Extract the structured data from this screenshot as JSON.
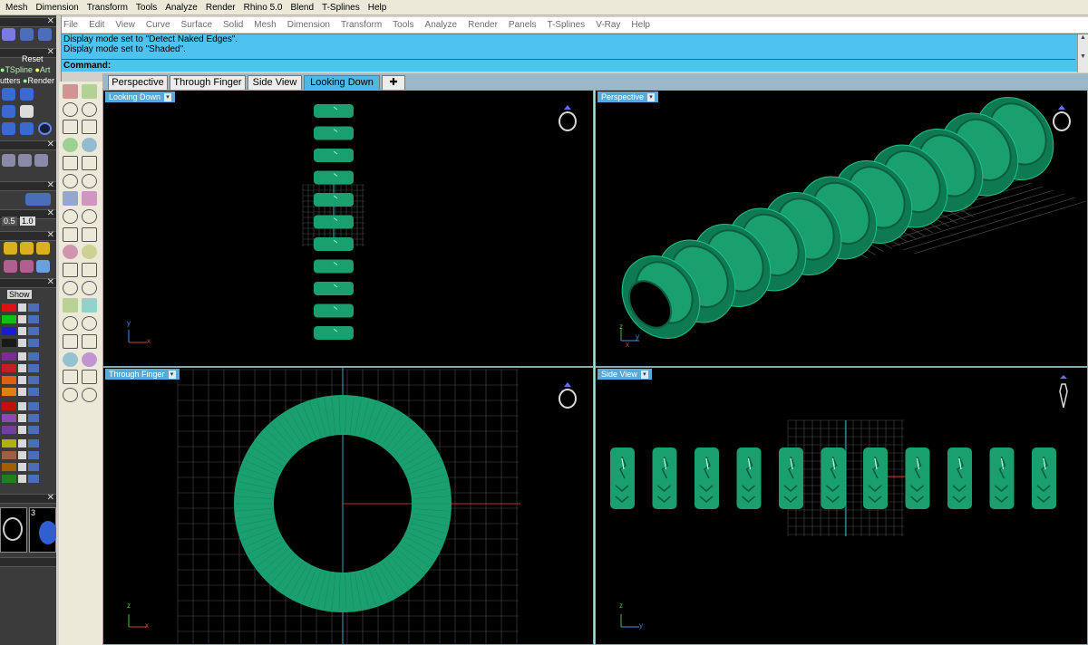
{
  "app_menu": [
    "Mesh",
    "Dimension",
    "Transform",
    "Tools",
    "Analyze",
    "Render",
    "Rhino 5.0",
    "Blend",
    "T-Splines",
    "Help"
  ],
  "rhino_menu": [
    "File",
    "Edit",
    "View",
    "Curve",
    "Surface",
    "Solid",
    "Mesh",
    "Dimension",
    "Transform",
    "Tools",
    "Analyze",
    "Render",
    "Panels",
    "T-Splines",
    "V-Ray",
    "Help"
  ],
  "command": {
    "history": [
      "Display mode set to \"Detect Naked Edges\".",
      "Display mode set to \"Shaded\"."
    ],
    "prompt": "Command:"
  },
  "left_panel": {
    "reset_label": "Reset",
    "row1": [
      "TSpline",
      "Art"
    ],
    "row2": [
      "utters",
      "Render"
    ],
    "field1": "0.5",
    "field2": "1.0",
    "show_label": "Show",
    "thumb_number": "3",
    "layer_colors": [
      "#e01010",
      "#10c010",
      "#1a1ad8",
      "#1a1a1a",
      "#7a2a9a",
      "#c02020",
      "#e06010",
      "#e08010",
      "#c01010",
      "#8a4ab0",
      "#7040a0",
      "#b0b010",
      "#a06040",
      "#a06000",
      "#208020"
    ]
  },
  "viewport_tabs": [
    "Perspective",
    "Through Finger",
    "Side View",
    "Looking Down"
  ],
  "active_tab": "Looking Down",
  "viewports": {
    "top_left": {
      "label": "Looking Down",
      "axes": [
        "y",
        "x"
      ]
    },
    "top_right": {
      "label": "Perspective",
      "axes": [
        "z",
        "y",
        "x"
      ]
    },
    "bottom_left": {
      "label": "Through Finger",
      "axes": [
        "z",
        "x"
      ]
    },
    "bottom_right": {
      "label": "Side View",
      "axes": [
        "z",
        "y"
      ]
    }
  },
  "colors": {
    "model_green": "#1a9f6e",
    "command_bar": "#4fc3f0",
    "viewport_bg": "#000000",
    "active_tab": "#4fb9e6",
    "grid": "#4a4a4a"
  },
  "icons": [
    "ring-icon",
    "close-icon",
    "dropdown-caret-icon",
    "add-tab-icon"
  ]
}
